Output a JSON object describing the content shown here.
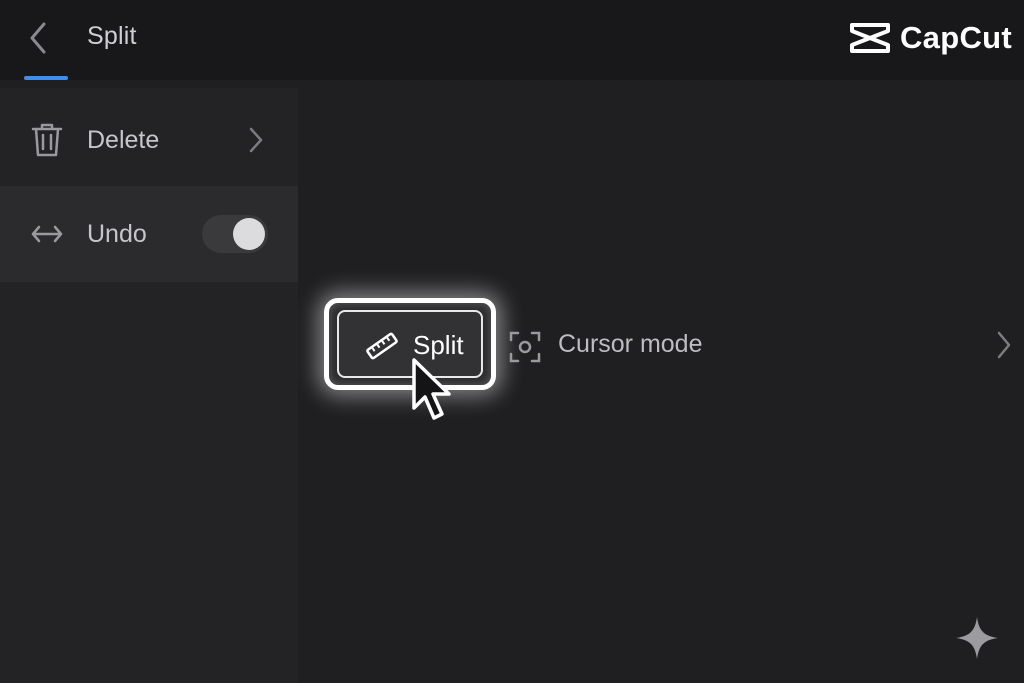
{
  "topbar": {
    "title": "Split",
    "brand_name": "CapCut"
  },
  "sidebar": {
    "items": [
      {
        "label": "Delete",
        "icon": "trash-icon"
      },
      {
        "label": "Undo",
        "icon": "horizontal-arrows-icon",
        "toggle_on": true
      }
    ]
  },
  "main": {
    "split_button_label": "Split",
    "cursor_mode_label": "Cursor mode"
  },
  "colors": {
    "accent": "#3d8ef0",
    "background": "#1f1f21",
    "sidebar": "#232325"
  }
}
